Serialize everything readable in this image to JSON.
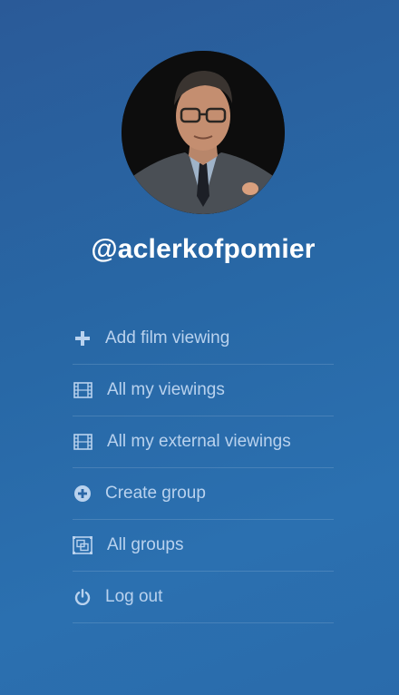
{
  "profile": {
    "username": "@aclerkofpomier",
    "avatar_alt": "profile-photo"
  },
  "menu": {
    "items": [
      {
        "label": "Add film viewing",
        "icon": "plus-icon"
      },
      {
        "label": "All my viewings",
        "icon": "film-icon"
      },
      {
        "label": "All my external viewings",
        "icon": "film-icon"
      },
      {
        "label": "Create group",
        "icon": "plus-circle-icon"
      },
      {
        "label": "All groups",
        "icon": "group-icon"
      },
      {
        "label": "Log out",
        "icon": "power-icon"
      }
    ]
  },
  "colors": {
    "background": "#2a66a6",
    "text": "#b9d2ee",
    "username": "#ffffff"
  }
}
